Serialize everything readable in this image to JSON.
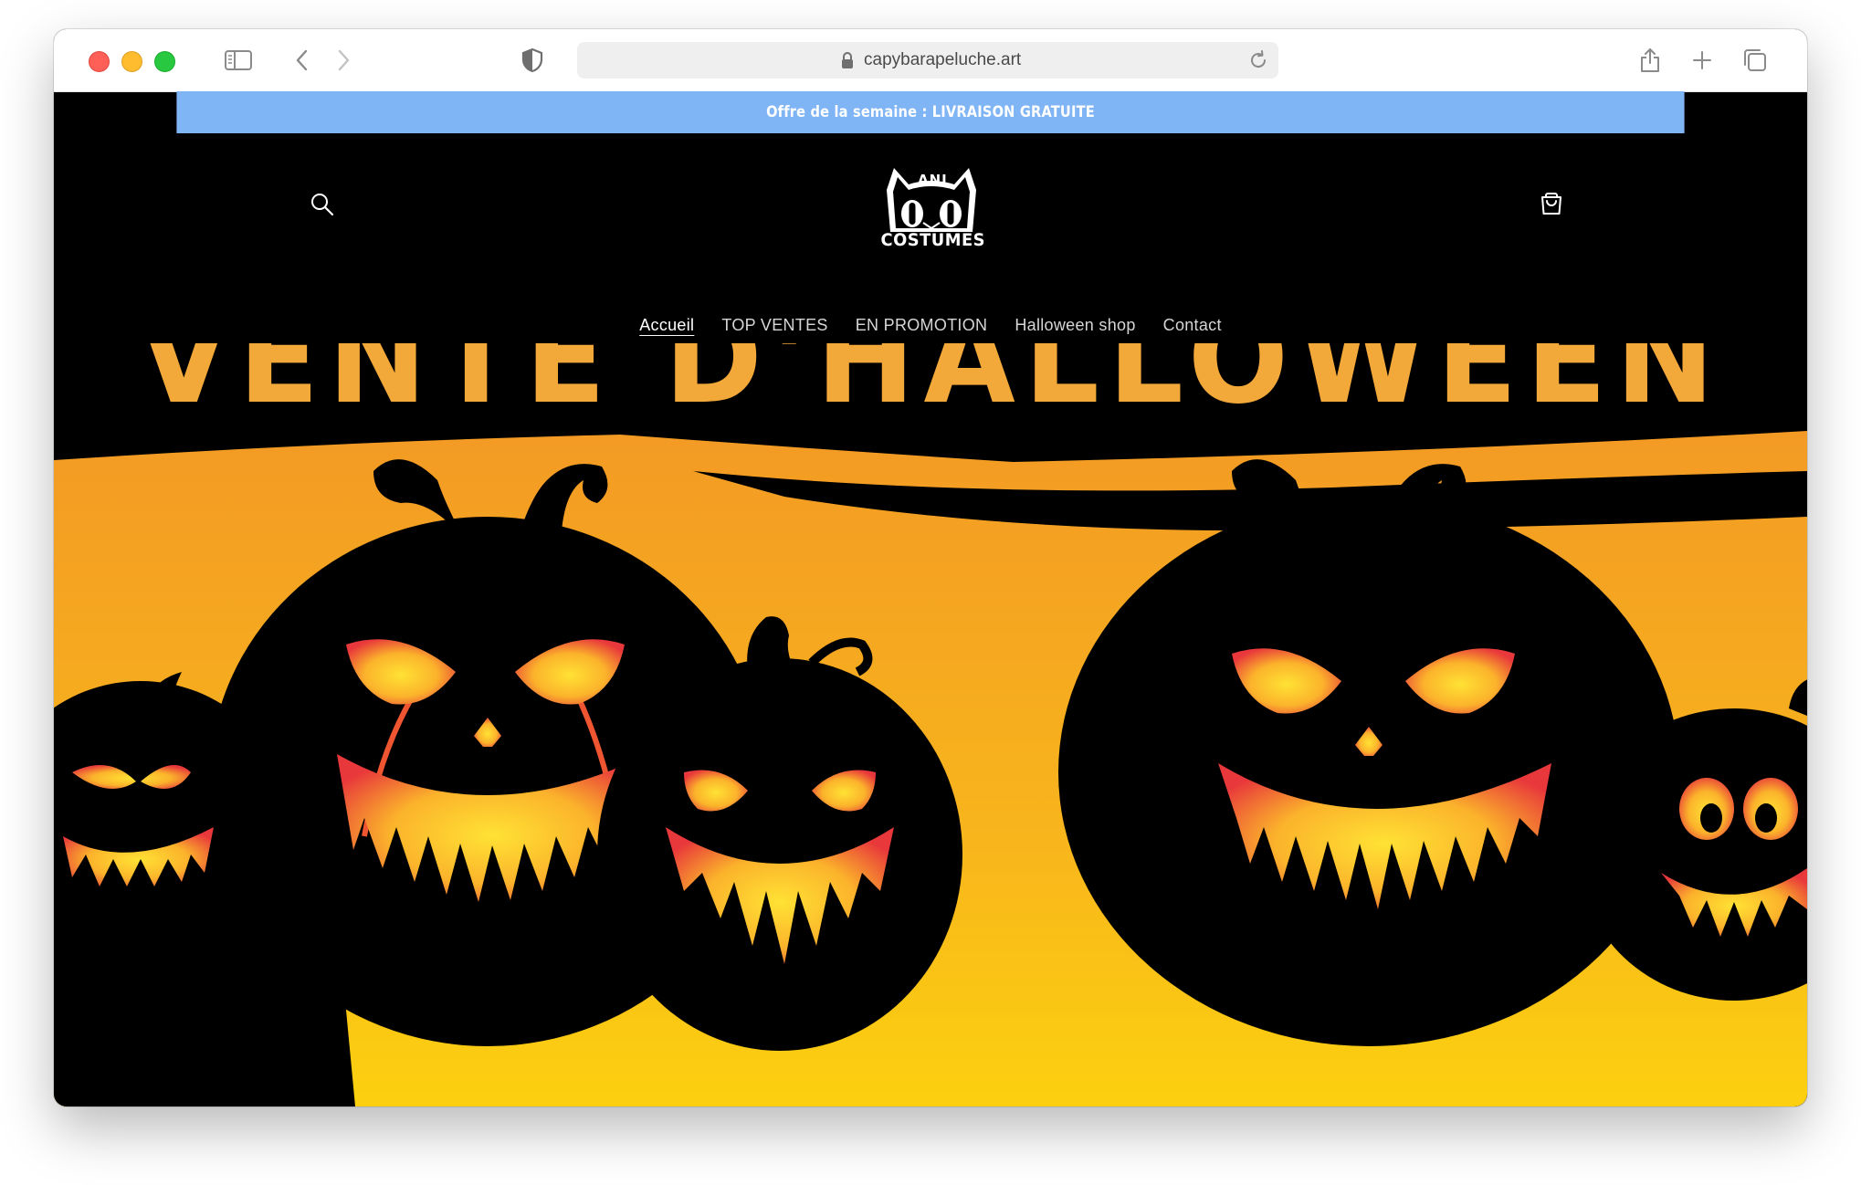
{
  "browser": {
    "url": "capybarapeluche.art",
    "icons": {
      "sidebar": "sidebar-icon",
      "back": "chevron-left-icon",
      "forward": "chevron-right-icon",
      "privacy": "shield-icon",
      "lock": "lock-icon",
      "reload": "reload-icon",
      "share": "share-icon",
      "new_tab": "plus-icon",
      "tabs": "tabs-overview-icon"
    }
  },
  "announcement": {
    "text": "Offre de la semaine : LIVRAISON GRATUITE",
    "background": "#7fb4f5"
  },
  "header": {
    "logo_top": "ANI",
    "logo_bottom": "COSTUMES",
    "search_icon": "search-icon",
    "cart_icon": "cart-icon"
  },
  "nav": {
    "items": [
      {
        "label": "Accueil",
        "active": true
      },
      {
        "label": "TOP VENTES",
        "active": false
      },
      {
        "label": "EN PROMOTION",
        "active": false
      },
      {
        "label": "Halloween shop",
        "active": false
      },
      {
        "label": "Contact",
        "active": false
      }
    ]
  },
  "hero": {
    "title": "VENTE D'HALLOWEEN",
    "colors": {
      "orange": "#f3a83a",
      "sky_top": "#f4a023",
      "sky_bottom": "#fcca10"
    }
  }
}
